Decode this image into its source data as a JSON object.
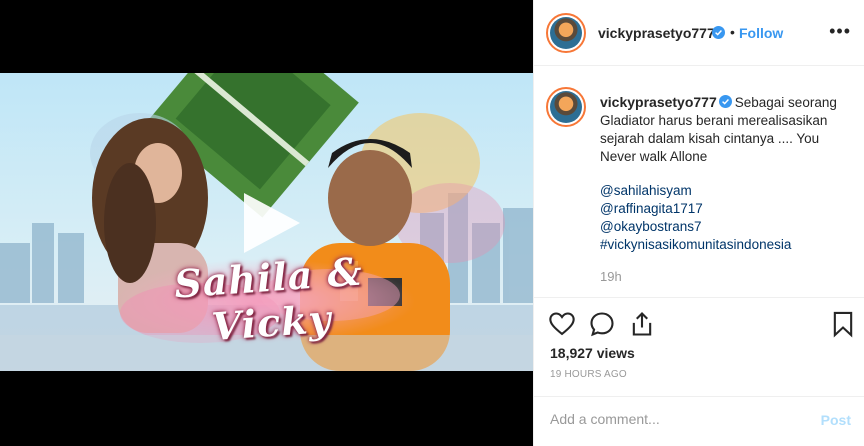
{
  "header": {
    "username": "vickyprasetyo777",
    "separator": "•",
    "follow_label": "Follow",
    "more_label": "•••"
  },
  "video": {
    "title_overlay": "Sahila & Vicky"
  },
  "caption": {
    "username": "vickyprasetyo777",
    "text": "Sebagai seorang Gladiator harus berani merealisasikan sejarah dalam kisah cintanya .... You Never walk Allone",
    "tags": [
      "@sahilahisyam",
      "@raffinagita1717",
      "@okaybostrans7",
      "#vickynisasikomunitasindonesia"
    ],
    "age": "19h"
  },
  "stats": {
    "views": "18,927 views",
    "timestamp": "19 HOURS AGO"
  },
  "comment": {
    "placeholder": "Add a comment...",
    "post_label": "Post"
  },
  "colors": {
    "accent": "#3897f0",
    "hashtag": "#003569",
    "post_disabled": "#b2dffc",
    "muted": "#999999"
  }
}
